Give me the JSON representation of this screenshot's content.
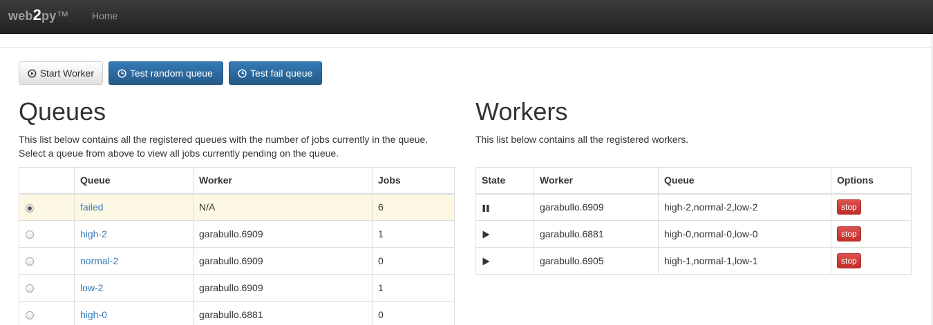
{
  "navbar": {
    "brand_prefix": "web",
    "brand_big": "2",
    "brand_suffix": "py",
    "brand_tm": "™",
    "home_label": "Home"
  },
  "toolbar": {
    "start_worker_label": "Start Worker",
    "test_random_label": "Test random queue",
    "test_fail_label": "Test fail queue"
  },
  "queues": {
    "title": "Queues",
    "desc_line1": "This list below contains all the registered queues with the number of jobs currently in the queue.",
    "desc_line2": "Select a queue from above to view all jobs currently pending on the queue.",
    "headers": {
      "select": "",
      "queue": "Queue",
      "worker": "Worker",
      "jobs": "Jobs"
    },
    "rows": [
      {
        "queue": "failed",
        "worker": "N/A",
        "jobs": "6",
        "selected": true
      },
      {
        "queue": "high-2",
        "worker": "garabullo.6909",
        "jobs": "1",
        "selected": false
      },
      {
        "queue": "normal-2",
        "worker": "garabullo.6909",
        "jobs": "0",
        "selected": false
      },
      {
        "queue": "low-2",
        "worker": "garabullo.6909",
        "jobs": "1",
        "selected": false
      },
      {
        "queue": "high-0",
        "worker": "garabullo.6881",
        "jobs": "0",
        "selected": false
      }
    ]
  },
  "workers": {
    "title": "Workers",
    "desc": "This list below contains all the registered workers.",
    "headers": {
      "state": "State",
      "worker": "Worker",
      "queue": "Queue",
      "options": "Options"
    },
    "rows": [
      {
        "state_icon": "pause-icon",
        "worker": "garabullo.6909",
        "queue": "high-2,normal-2,low-2",
        "stop_label": "stop"
      },
      {
        "state_icon": "play-icon",
        "worker": "garabullo.6881",
        "queue": "high-0,normal-0,low-0",
        "stop_label": "stop"
      },
      {
        "state_icon": "play-icon",
        "worker": "garabullo.6905",
        "queue": "high-1,normal-1,low-1",
        "stop_label": "stop"
      }
    ]
  },
  "colors": {
    "navbar": "#222222",
    "primary": "#337ab7",
    "danger": "#d9534f",
    "selected_row": "#fcf8e3",
    "link": "#337ab7"
  }
}
